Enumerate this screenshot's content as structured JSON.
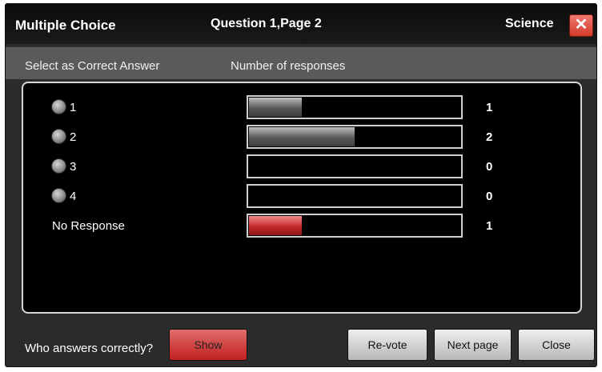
{
  "window": {
    "title": "Multiple Choice",
    "question_info": "Question 1,Page 2",
    "subject": "Science",
    "close_label": "✕"
  },
  "header": {
    "select_label": "Select as Correct Answer",
    "responses_label": "Number of responses"
  },
  "answers": [
    {
      "label": "1",
      "count": "1",
      "fraction": 0.25
    },
    {
      "label": "2",
      "count": "2",
      "fraction": 0.5
    },
    {
      "label": "3",
      "count": "0",
      "fraction": 0
    },
    {
      "label": "4",
      "count": "0",
      "fraction": 0
    }
  ],
  "no_response": {
    "label": "No Response",
    "count": "1",
    "fraction": 0.25
  },
  "footer": {
    "question_label": "Who answers correctly?",
    "show_label": "Show",
    "revote_label": "Re-vote",
    "next_page_label": "Next page",
    "close_label": "Close"
  },
  "colors": {
    "bar_gray": "#5a5a5a",
    "bar_red": "#c42a2a",
    "close_red": "#d23a2a"
  }
}
